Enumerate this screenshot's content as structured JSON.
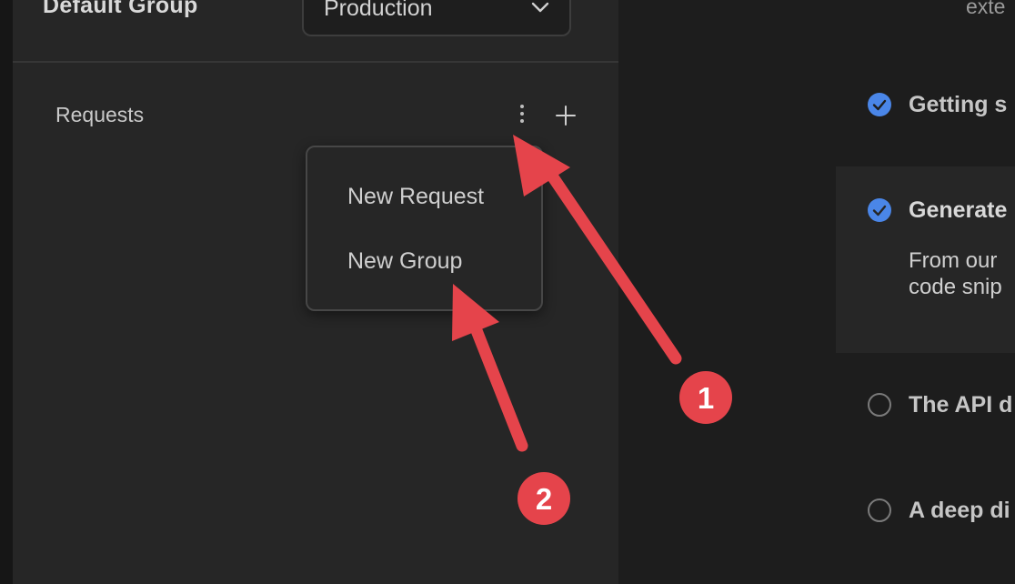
{
  "sidebar": {
    "group_title": "Default Group",
    "environment_select": {
      "value": "Production",
      "icon": "chevron-down-icon"
    },
    "requests_label": "Requests",
    "actions": {
      "more_icon": "kebab-icon",
      "add_icon": "plus-icon"
    },
    "menu": {
      "items": [
        {
          "label": "New Request"
        },
        {
          "label": "New Group"
        }
      ]
    }
  },
  "main": {
    "header_fragment": "exte",
    "steps": [
      {
        "title": "Getting s",
        "status": "completed"
      },
      {
        "title": "Generate",
        "status": "completed",
        "description_lines": [
          "From our",
          "code snip"
        ]
      },
      {
        "title": "The API d",
        "status": "pending"
      },
      {
        "title": "A deep di",
        "status": "pending"
      }
    ]
  },
  "annotations": {
    "badges": [
      "1",
      "2"
    ],
    "color": "#e5444b"
  },
  "colors": {
    "accent_check": "#4a86e8",
    "annotation": "#e5444b"
  }
}
